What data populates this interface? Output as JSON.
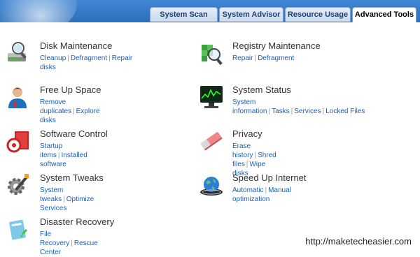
{
  "tabs": [
    "System Scan",
    "System Advisor",
    "Resource Usage",
    "Advanced Tools"
  ],
  "active_tab": "Advanced Tools",
  "items": [
    {
      "title": "Disk Maintenance",
      "links": [
        "Cleanup",
        "Defragment",
        "Repair disks"
      ],
      "icon": "disk-maintenance-icon"
    },
    {
      "title": "Registry Maintenance",
      "links": [
        "Repair",
        "Defragment"
      ],
      "icon": "registry-maintenance-icon"
    },
    {
      "title": "Free Up Space",
      "links": [
        "Remove duplicates",
        "Explore disks"
      ],
      "icon": "free-up-space-icon"
    },
    {
      "title": "System Status",
      "links": [
        "System information",
        "Tasks",
        "Services",
        "Locked Files"
      ],
      "icon": "system-status-icon"
    },
    {
      "title": "Software Control",
      "links": [
        "Startup items",
        "Installed software"
      ],
      "icon": "software-control-icon"
    },
    {
      "title": "Privacy",
      "links": [
        "Erase history",
        "Shred files",
        "Wipe disks"
      ],
      "icon": "privacy-eraser-icon"
    },
    {
      "title": "System Tweaks",
      "links": [
        "System tweaks",
        "Optimize Services"
      ],
      "icon": "system-tweaks-icon"
    },
    {
      "title": "Speed Up Internet",
      "links": [
        "Automatic",
        "Manual optimization"
      ],
      "icon": "speed-up-internet-icon"
    },
    {
      "title": "Disaster Recovery",
      "links": [
        "File Recovery",
        "Rescue Center"
      ],
      "icon": "disaster-recovery-icon"
    }
  ],
  "watermark": "http://maketecheasier.com"
}
